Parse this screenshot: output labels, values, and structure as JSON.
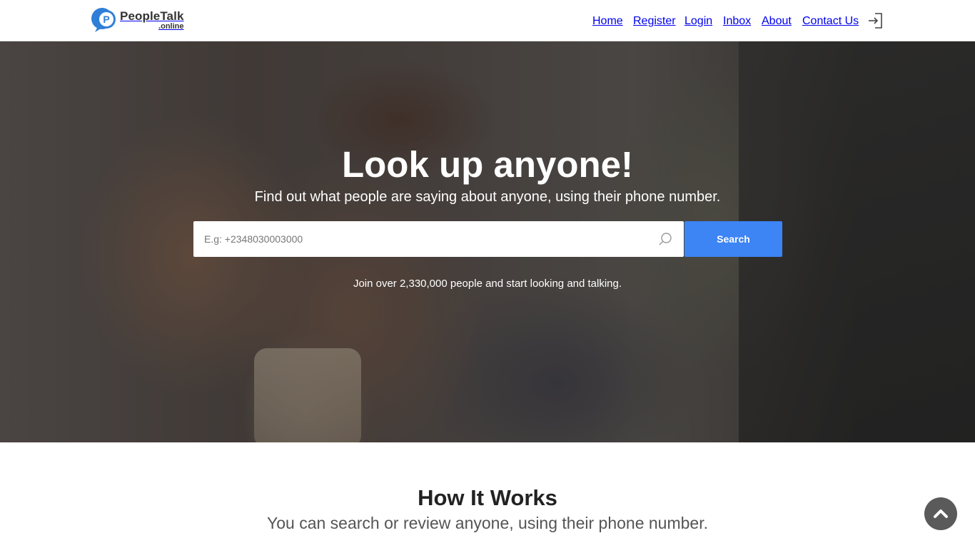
{
  "header": {
    "logo": {
      "brand": "PeopleTalk",
      "tld": ".online",
      "mark_letter": "P",
      "icon": "logo-speech-bubble-icon",
      "colors": {
        "bubble": "#2f7fd8",
        "text": "#333333"
      }
    },
    "nav": {
      "home": "Home",
      "register": "Register",
      "login": "Login",
      "inbox": "Inbox",
      "about": "About",
      "contact": "Contact Us",
      "signin_icon": "sign-in-icon"
    }
  },
  "hero": {
    "title": "Look up anyone!",
    "subtitle": "Find out what people are saying about anyone, using their phone number.",
    "search": {
      "placeholder": "E.g: +2348030003000",
      "value": "",
      "button_label": "Search",
      "icon": "search-icon"
    },
    "join_text": "Join over 2,330,000 people and start looking and talking.",
    "colors": {
      "button": "#3d84f5",
      "text": "#ffffff"
    }
  },
  "how_it_works": {
    "title": "How It Works",
    "subtitle": "You can search or review anyone, using their phone number."
  },
  "back_to_top": {
    "icon": "chevron-up-icon",
    "color": "#5a5a5a"
  }
}
